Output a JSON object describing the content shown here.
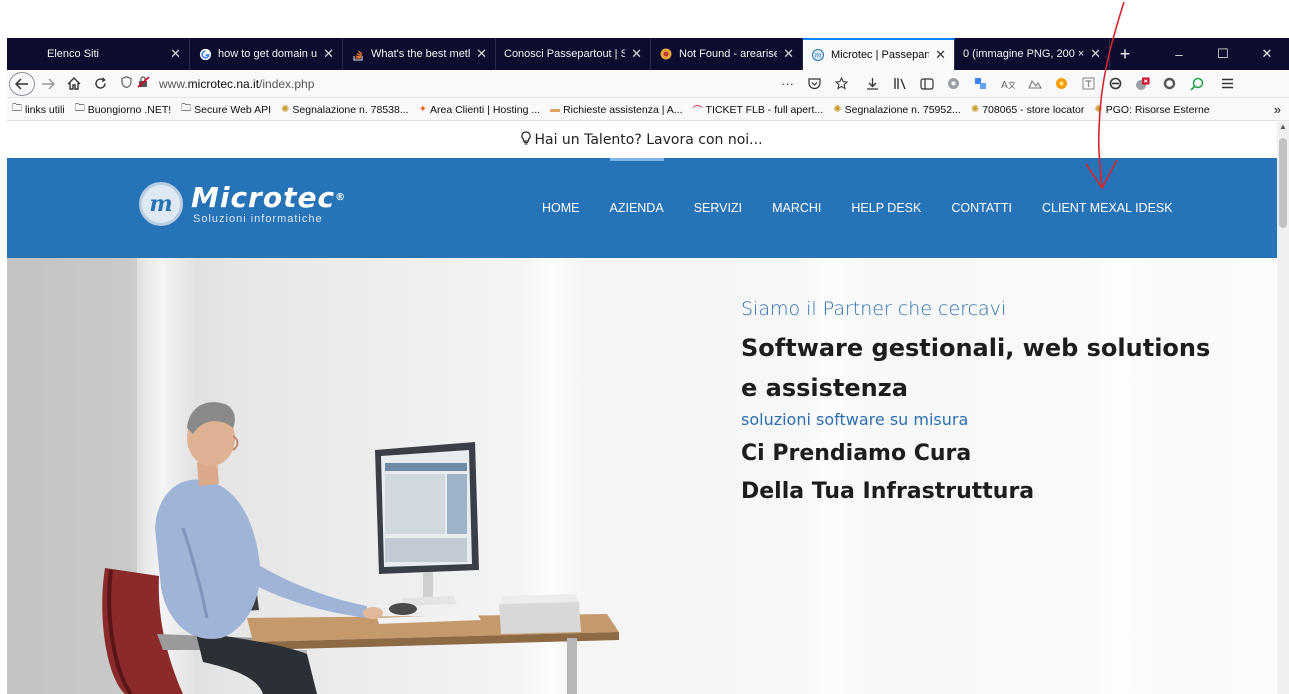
{
  "colors": {
    "tabstrip_bg": "#0c0c2e",
    "active_tab_accent": "#0a84ff",
    "site_header_bg": "#2673b8",
    "hero_accent_text": "#2a6fb0",
    "annotation_arrow": "#d4262e"
  },
  "browser": {
    "tabs": [
      {
        "label": "Elenco Siti",
        "icon": "globe-icon",
        "active": false
      },
      {
        "label": "how to get domain ul",
        "icon": "google-icon",
        "active": false
      },
      {
        "label": "What's the best meth",
        "icon": "stackoverflow-icon",
        "active": false
      },
      {
        "label": "Conosci Passepartout | So",
        "icon": "",
        "active": false
      },
      {
        "label": "Not Found - areariser",
        "icon": "site-icon",
        "active": false
      },
      {
        "label": "Microtec | Passeparto",
        "icon": "microtec-icon",
        "active": true
      },
      {
        "label": "0 (immagine PNG, 200 ×",
        "icon": "",
        "active": false
      }
    ],
    "new_tab_symbol": "+",
    "window_controls": {
      "minimize": "–",
      "maximize": "☐",
      "close": "✕"
    },
    "url": {
      "prefix": "www.",
      "host": "microtec.na.it",
      "path": "/index.php"
    },
    "page_actions_symbol": "···",
    "bookmarks": [
      {
        "label": "links utili",
        "icon": "folder-icon"
      },
      {
        "label": "Buongiorno .NET!",
        "icon": "folder-icon"
      },
      {
        "label": "Secure Web API",
        "icon": "folder-icon"
      },
      {
        "label": "Segnalazione n. 78538...",
        "icon": "badge-icon"
      },
      {
        "label": "Area Clienti | Hosting ...",
        "icon": "star-icon"
      },
      {
        "label": "Richieste assistenza | A...",
        "icon": "support-icon"
      },
      {
        "label": "TICKET FLB - full apert...",
        "icon": "ticket-icon"
      },
      {
        "label": "Segnalazione n. 75952...",
        "icon": "badge-icon"
      },
      {
        "label": "708065 - store locator",
        "icon": "badge-icon"
      },
      {
        "label": "PGO: Risorse Esterne",
        "icon": "badge-icon"
      }
    ],
    "bookmarks_overflow": "»"
  },
  "site": {
    "topbar_text": "Hai un Talento? Lavora con noi...",
    "logo": {
      "mark_letter": "m",
      "name": "Microtec",
      "registered": "®",
      "tagline": "Soluzioni informatiche"
    },
    "nav": [
      {
        "label": "HOME",
        "active": false
      },
      {
        "label": "AZIENDA",
        "active": true
      },
      {
        "label": "SERVIZI",
        "active": false
      },
      {
        "label": "MARCHI",
        "active": false
      },
      {
        "label": "HELP DESK",
        "active": false
      },
      {
        "label": "CONTATTI",
        "active": false
      },
      {
        "label": "CLIENT MEXAL IDESK",
        "active": false
      }
    ],
    "hero": {
      "kicker": "Siamo il Partner che cercavi",
      "title_line1": "Software gestionali, web solutions",
      "title_line2": "e assistenza",
      "subtitle": "soluzioni software su misura",
      "claim_line1": "Ci Prendiamo Cura",
      "claim_line2": "Della Tua Infrastruttura"
    }
  }
}
